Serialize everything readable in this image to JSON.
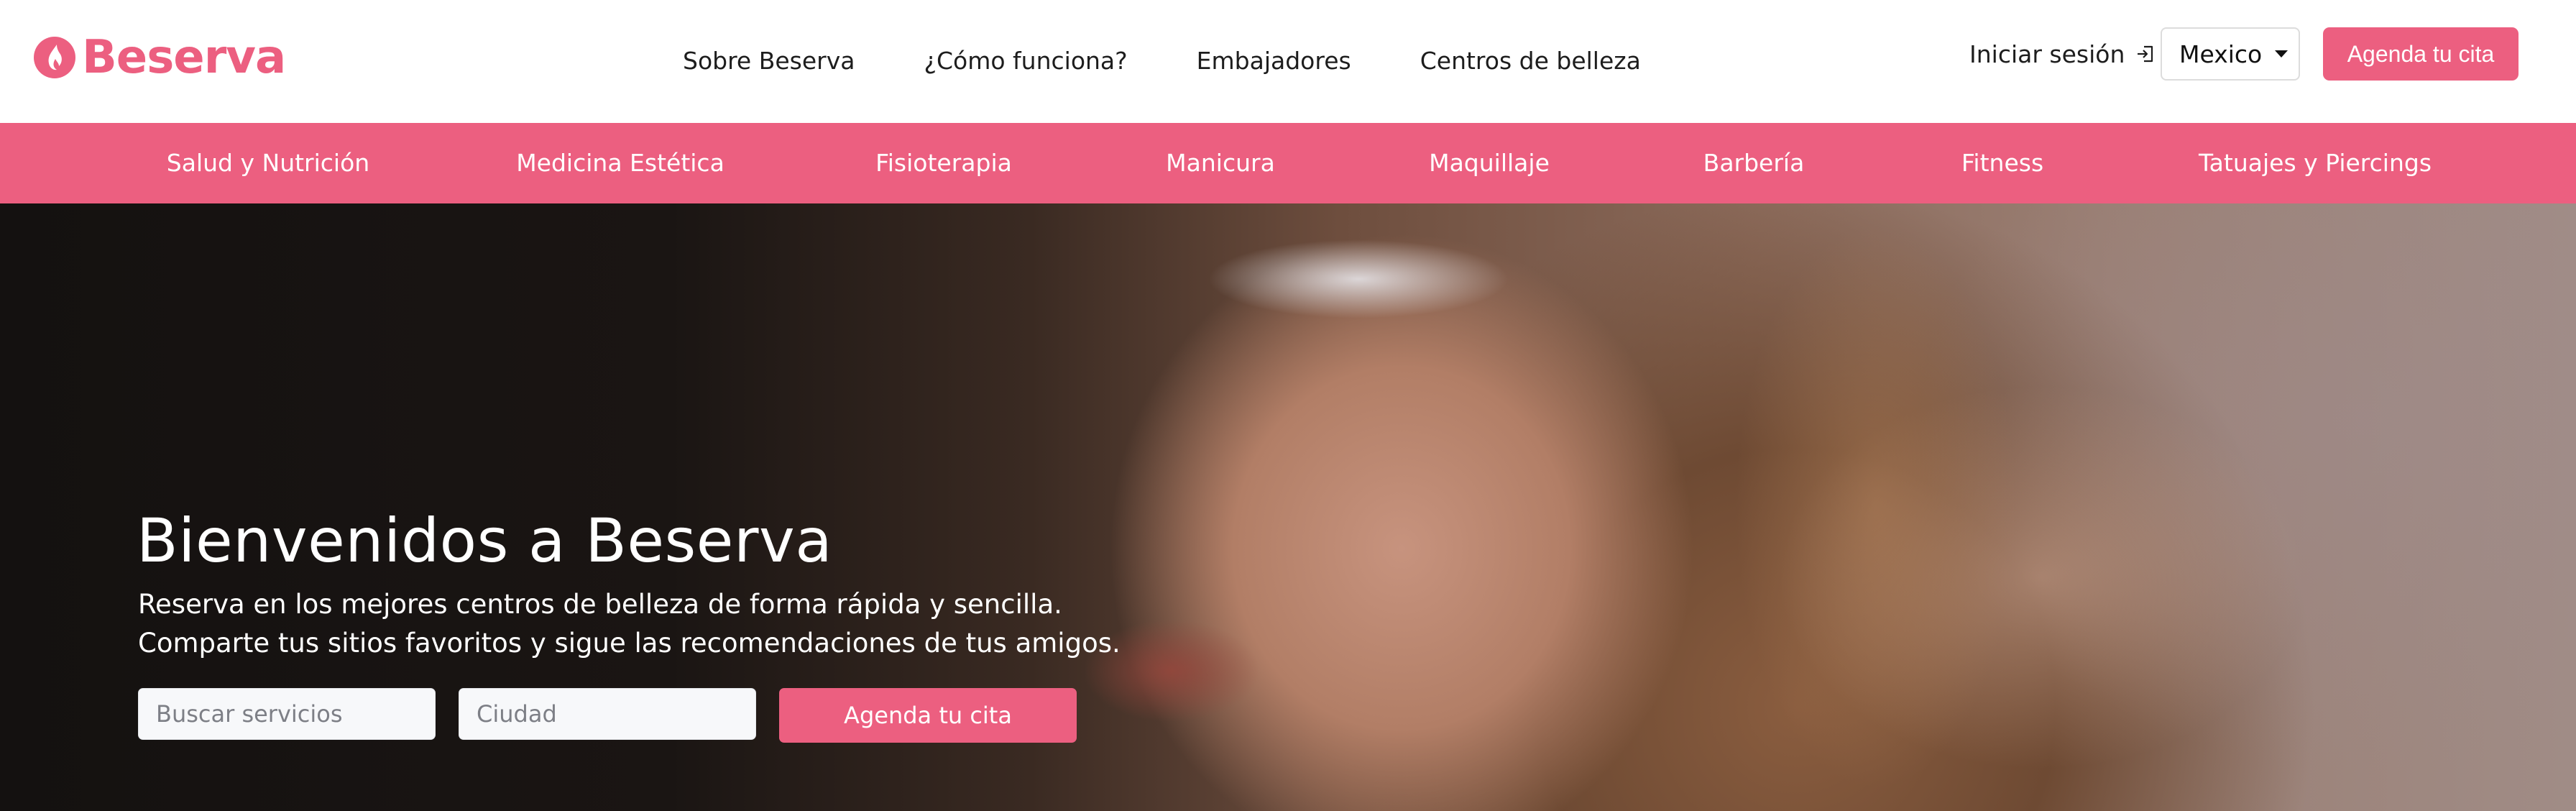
{
  "brand": {
    "name": "Beserva",
    "accent_color": "#ec5f80",
    "logo_icon": "flame-drop-icon"
  },
  "header": {
    "nav": [
      {
        "label": "Sobre Beserva"
      },
      {
        "label": "¿Cómo funciona?"
      },
      {
        "label": "Embajadores"
      },
      {
        "label": "Centros de belleza"
      }
    ],
    "login_label": "Iniciar sesión",
    "login_icon": "sign-in-icon",
    "country_selected": "Mexico",
    "cta_label": "Agenda tu cita"
  },
  "categories": [
    {
      "label": "Salud y Nutrición"
    },
    {
      "label": "Medicina Estética"
    },
    {
      "label": "Fisioterapia"
    },
    {
      "label": "Manicura"
    },
    {
      "label": "Maquillaje"
    },
    {
      "label": "Barbería"
    },
    {
      "label": "Fitness"
    },
    {
      "label": "Tatuajes y Piercings"
    }
  ],
  "hero": {
    "title": "Bienvenidos a Beserva",
    "subtitle_line1": "Reserva en los mejores centros de belleza de forma rápida y sencilla.",
    "subtitle_line2": "Comparte tus sitios favoritos y sigue las recomendaciones de tus amigos.",
    "search_placeholder": "Buscar servicios",
    "city_placeholder": "Ciudad",
    "cta_label": "Agenda tu cita"
  }
}
